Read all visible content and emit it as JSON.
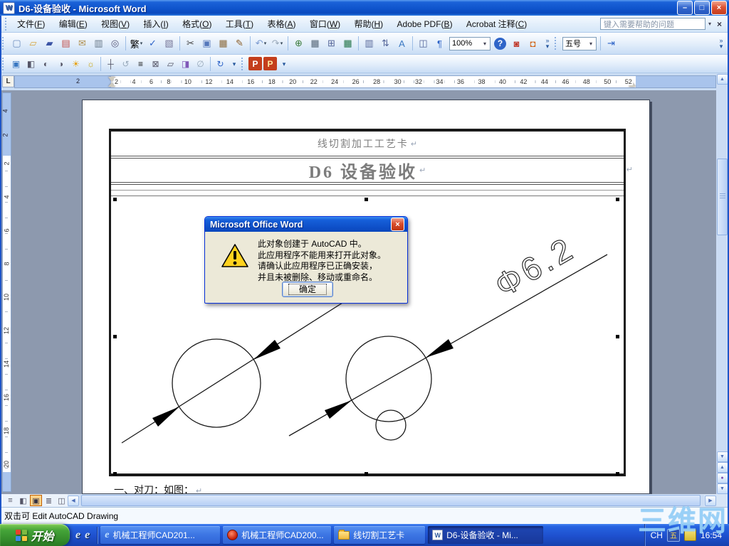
{
  "window": {
    "title": "D6-设备验收 - Microsoft Word"
  },
  "glyphs": {
    "caret": "▾",
    "chevron": "»",
    "close": "×",
    "minimize": "–",
    "restore": "□",
    "pilcrow": "↵",
    "left": "◀",
    "right": "▶",
    "up": "▲",
    "down": "▼",
    "dot": "●"
  },
  "menu": {
    "items": [
      {
        "pre": "文件(",
        "key": "F",
        "post": ")"
      },
      {
        "pre": "编辑(",
        "key": "E",
        "post": ")"
      },
      {
        "pre": "视图(",
        "key": "V",
        "post": ")"
      },
      {
        "pre": "插入(",
        "key": "I",
        "post": ")"
      },
      {
        "pre": "格式(",
        "key": "O",
        "post": ")"
      },
      {
        "pre": "工具(",
        "key": "T",
        "post": ")"
      },
      {
        "pre": "表格(",
        "key": "A",
        "post": ")"
      },
      {
        "pre": "窗口(",
        "key": "W",
        "post": ")"
      },
      {
        "pre": "帮助(",
        "key": "H",
        "post": ")"
      },
      {
        "pre": "Adobe PDF(",
        "key": "B",
        "post": ")"
      },
      {
        "pre": "Acrobat 注释(",
        "key": "C",
        "post": ")"
      }
    ],
    "help_placeholder": "键入需要帮助的问题"
  },
  "toolbar": {
    "zoom_value": "100%",
    "font_size": "五号",
    "std_a": [
      {
        "name": "new-document-icon",
        "glyph": "▢",
        "color": "#6C8EBF"
      },
      {
        "name": "open-folder-icon",
        "glyph": "▱",
        "color": "#D9A43B"
      },
      {
        "name": "save-icon",
        "glyph": "▰",
        "color": "#3C55A5"
      },
      {
        "name": "permission-icon",
        "glyph": "▤",
        "color": "#C0504D"
      },
      {
        "name": "mail-icon",
        "glyph": "✉",
        "color": "#B09050"
      },
      {
        "name": "print-icon",
        "glyph": "▥",
        "color": "#667788"
      },
      {
        "name": "print-preview-icon",
        "glyph": "◎",
        "color": "#555577"
      }
    ],
    "std_b": [
      {
        "name": "traditional-convert-icon",
        "glyph": "繁",
        "color": "#000000",
        "caret": true
      },
      {
        "name": "spelling-icon",
        "glyph": "✓",
        "color": "#2E64C8"
      },
      {
        "name": "research-icon",
        "glyph": "▧",
        "color": "#777799"
      }
    ],
    "std_c": [
      {
        "name": "cut-icon",
        "glyph": "✂",
        "color": "#444444"
      },
      {
        "name": "copy-icon",
        "glyph": "▣",
        "color": "#5577BB"
      },
      {
        "name": "paste-icon",
        "glyph": "▦",
        "color": "#8B6A3C"
      },
      {
        "name": "format-painter-icon",
        "glyph": "✎",
        "color": "#8B5E2A"
      }
    ],
    "std_d": [
      {
        "name": "undo-icon",
        "glyph": "↶",
        "color": "#7A9AD0",
        "caret": true
      },
      {
        "name": "redo-icon",
        "glyph": "↷",
        "color": "#9AAABB",
        "caret": true
      }
    ],
    "std_e": [
      {
        "name": "hyperlink-icon",
        "glyph": "⊕",
        "color": "#3A7A3A"
      },
      {
        "name": "tables-borders-icon",
        "glyph": "▦",
        "color": "#556677"
      },
      {
        "name": "insert-table-icon",
        "glyph": "⊞",
        "color": "#556699"
      },
      {
        "name": "insert-excel-icon",
        "glyph": "▦",
        "color": "#217346"
      }
    ],
    "std_f": [
      {
        "name": "columns-icon",
        "glyph": "▥",
        "color": "#556699"
      },
      {
        "name": "sort-icon",
        "glyph": "⇅",
        "color": "#556699"
      },
      {
        "name": "wordart-icon",
        "glyph": "A",
        "color": "#3A78C2"
      }
    ],
    "std_g": [
      {
        "name": "document-map-icon",
        "glyph": "◫",
        "color": "#556699"
      },
      {
        "name": "show-hide-icon",
        "glyph": "¶",
        "color": "#2E64C8"
      }
    ],
    "std_h": [
      {
        "name": "help-icon",
        "glyph": "?",
        "color": "#FFFFFF",
        "bg": "#2E64C8",
        "round": true
      },
      {
        "name": "doc-search-icon",
        "glyph": "◙",
        "color": "#C0392B"
      },
      {
        "name": "reading-layout-icon",
        "glyph": "◘",
        "color": "#D2691E"
      }
    ],
    "fmt": [
      {
        "name": "indent-icon",
        "glyph": "⇥",
        "color": "#2E64C8"
      }
    ],
    "pic_a": [
      {
        "name": "insert-picture-icon",
        "glyph": "▣",
        "color": "#3A78C2"
      },
      {
        "name": "color-mode-icon",
        "glyph": "◧",
        "color": "#555566"
      },
      {
        "name": "more-contrast-icon",
        "glyph": "◐",
        "color": "#555566"
      },
      {
        "name": "less-contrast-icon",
        "glyph": "◑",
        "color": "#555566"
      },
      {
        "name": "more-brightness-icon",
        "glyph": "☀",
        "color": "#E8A000"
      },
      {
        "name": "less-brightness-icon",
        "glyph": "☼",
        "color": "#C8A000"
      }
    ],
    "pic_b": [
      {
        "name": "crop-icon",
        "glyph": "┼",
        "color": "#555566"
      },
      {
        "name": "rotate-left-icon",
        "glyph": "↺",
        "color": "#99AABB"
      },
      {
        "name": "line-style-icon",
        "glyph": "≡",
        "color": "#111111"
      },
      {
        "name": "compress-pictures-icon",
        "glyph": "⊠",
        "color": "#555566"
      },
      {
        "name": "text-wrapping-icon",
        "glyph": "▱",
        "color": "#555566"
      },
      {
        "name": "format-picture-icon",
        "glyph": "◨",
        "color": "#8058B8"
      },
      {
        "name": "set-transparent-color-icon",
        "glyph": "∅",
        "color": "#99AABB"
      }
    ],
    "pic_c": [
      {
        "name": "reset-picture-icon",
        "glyph": "↻",
        "color": "#2E64C8"
      }
    ],
    "pdf": [
      {
        "name": "convert-to-pdf-icon",
        "glyph": "P",
        "color": "#FFFFFF",
        "bg": "#C43E1C"
      },
      {
        "name": "pdf-comment-icon",
        "glyph": "P",
        "color": "#FFE8A0",
        "bg": "#C43E1C"
      }
    ]
  },
  "ruler": {
    "tab_selector": "L",
    "h_margin_number": "2",
    "h_numbers": [
      "2",
      "4",
      "6",
      "8",
      "10",
      "12",
      "14",
      "16",
      "18",
      "20",
      "22",
      "24",
      "26",
      "28",
      "30",
      "32",
      "34",
      "36",
      "38",
      "40",
      "42",
      "44",
      "46",
      "48",
      "50",
      "52"
    ],
    "v_margin_numbers": [
      "4",
      "2"
    ],
    "v_numbers": [
      "2",
      "4",
      "6",
      "8",
      "10",
      "12",
      "14",
      "16",
      "18",
      "20"
    ]
  },
  "document": {
    "header_small": "线切割加工工艺卡",
    "title": "D6 设备验收",
    "body_line": "一、对刀：如图："
  },
  "drawing": {
    "dim_label": "Φ6.2"
  },
  "dialog": {
    "title": "Microsoft Office Word",
    "lines": [
      "此对象创建于 AutoCAD 中。",
      "此应用程序不能用来打开此对象。",
      "请确认此应用程序已正确安装，",
      "并且未被删除、移动或重命名。"
    ],
    "ok_label": "确定"
  },
  "statusbar": {
    "text": "双击可 Edit AutoCAD Drawing"
  },
  "taskbar": {
    "start_label": "开始",
    "tasks": [
      {
        "label": "机械工程师CAD201..."
      },
      {
        "label": "机械工程师CAD200..."
      },
      {
        "label": "线切割工艺卡"
      },
      {
        "label": "D6-设备验收 - Mi...",
        "active": true
      }
    ],
    "tray": {
      "lang": "CH",
      "time": "16:54"
    }
  },
  "watermark": {
    "text": "三维网"
  },
  "colors": {
    "accent": "#2E64C8",
    "taskbar_blue": "#245EDC",
    "start_green": "#3B9B3B",
    "dialog_bg": "#ECE9D8",
    "pasteboard": "#8D99AE",
    "doc_gray_text": "#7F7F7F"
  }
}
